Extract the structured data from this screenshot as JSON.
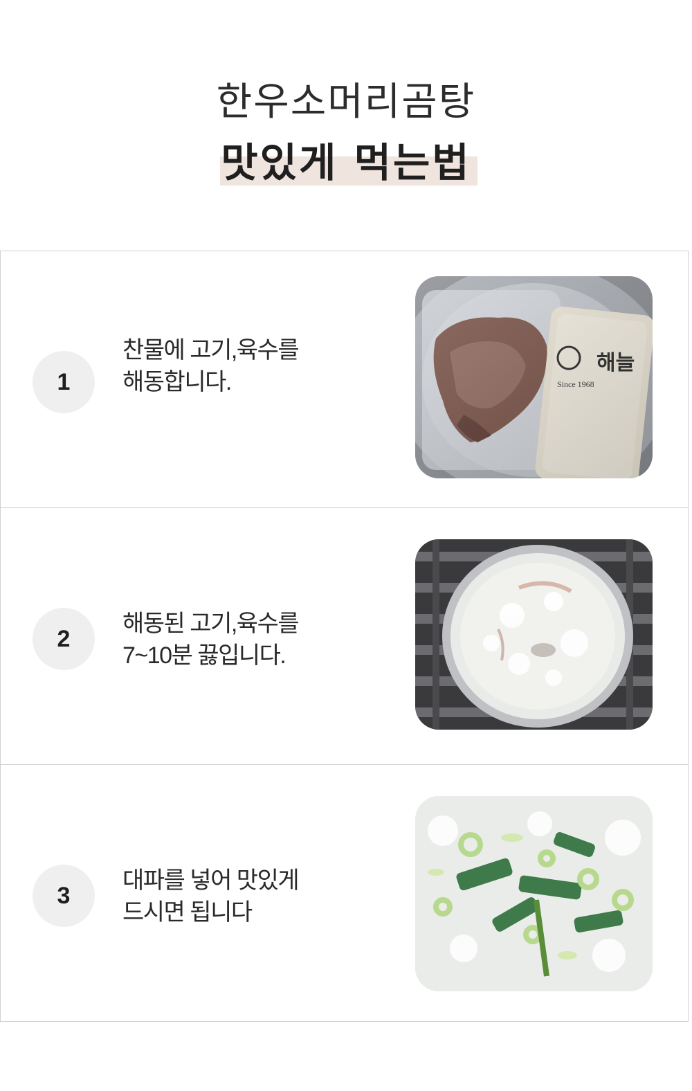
{
  "header": {
    "title_line1": "한우소머리곰탕",
    "title_line2": "맛있게 먹는법"
  },
  "steps": [
    {
      "number": "1",
      "text_line1": "찬물에 고기,육수를",
      "text_line2": "해동합니다.",
      "image_desc": "photo-frozen-beef-and-broth-packs",
      "pack_brand": "해늘",
      "pack_since": "Since 1968"
    },
    {
      "number": "2",
      "text_line1": "해동된 고기,육수를",
      "text_line2": "7~10분 끓입니다.",
      "image_desc": "photo-boiling-pot-on-grate"
    },
    {
      "number": "3",
      "text_line1": "대파를 넣어 맛있게",
      "text_line2": "드시면 됩니다",
      "image_desc": "photo-soup-with-green-onion"
    }
  ],
  "colors": {
    "highlight": "#f0e4df",
    "number_circle": "#efefef",
    "border": "#cfcfcf"
  }
}
